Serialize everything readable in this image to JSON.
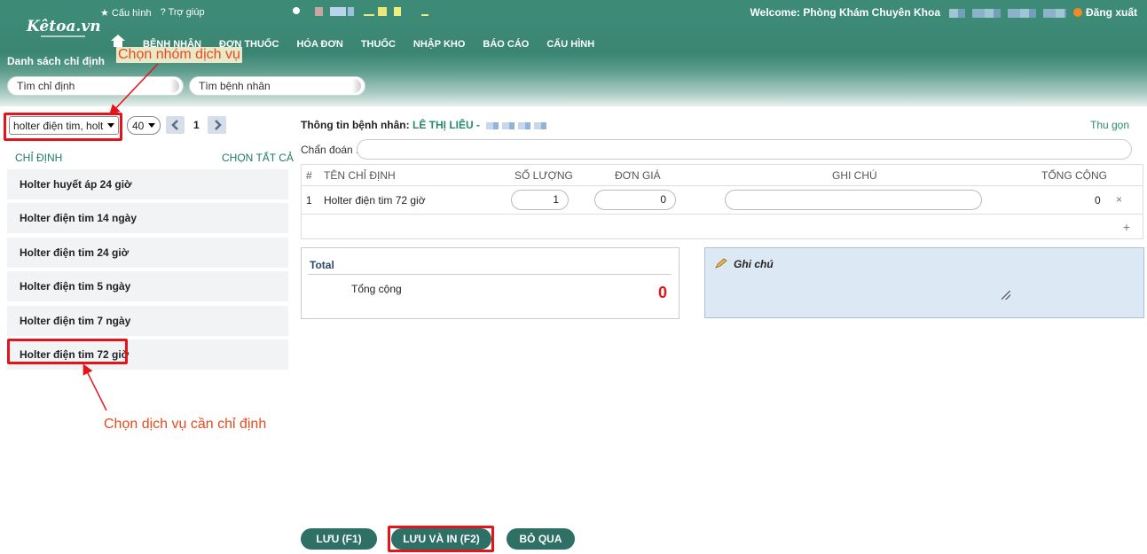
{
  "header": {
    "logo_text": "Kêtoa.vn",
    "top_links": [
      "Cấu hình",
      "Trợ giúp"
    ],
    "welcome": "Welcome: Phòng Khám Chuyên Khoa",
    "logout": "Đăng xuất"
  },
  "nav": {
    "items": [
      "BỆNH NHÂN",
      "ĐƠN THUỐC",
      "HÓA ĐƠN",
      "THUỐC",
      "NHẬP KHO",
      "BÁO CÁO",
      "CẤU HÌNH"
    ]
  },
  "section_title": "Danh sách chỉ định",
  "search": {
    "order_placeholder": "Tìm chỉ định",
    "patient_placeholder": "Tìm bệnh nhân"
  },
  "left": {
    "group_value": "holter điện tim, holt",
    "page_size": "40",
    "page": "1",
    "list_header": "CHỈ ĐỊNH",
    "select_all": "CHỌN TẤT CẢ",
    "services": [
      "Holter huyết áp 24 giờ",
      "Holter điện tim 14 ngày",
      "Holter điện tim 24 giờ",
      "Holter điện tim 5 ngày",
      "Holter điện tim 7 ngày",
      "Holter điện tim 72 giờ"
    ]
  },
  "annotations": {
    "group_hint": "Chọn nhóm dịch vụ",
    "service_hint": "Chọn dịch vụ cần chỉ định"
  },
  "patient": {
    "label": "Thông tin bệnh nhân:",
    "name": "LÊ THỊ LIỄU -",
    "collapse": "Thu gọn",
    "diagnosis_label": "Chẩn đoán :"
  },
  "table": {
    "headers": [
      "#",
      "TÊN CHỈ ĐỊNH",
      "SỐ LƯỢNG",
      "ĐƠN GIÁ",
      "GHI CHÚ",
      "TỔNG CỘNG"
    ],
    "rows": [
      {
        "index": "1",
        "name": "Holter điện tim 72 giờ",
        "qty": "1",
        "price": "0",
        "note": "",
        "total": "0"
      }
    ],
    "remove_symbol": "×",
    "add_symbol": "+"
  },
  "total": {
    "title": "Total",
    "label": "Tổng cộng",
    "value": "0"
  },
  "note": {
    "title": "Ghi chú"
  },
  "buttons": {
    "save": "LƯU (F1)",
    "save_print": "LƯU VÀ IN (F2)",
    "skip": "BỎ QUA"
  },
  "colors": {
    "brand": "#3d8a77",
    "button": "#2e6f66",
    "annotation_red": "#e5141b"
  }
}
